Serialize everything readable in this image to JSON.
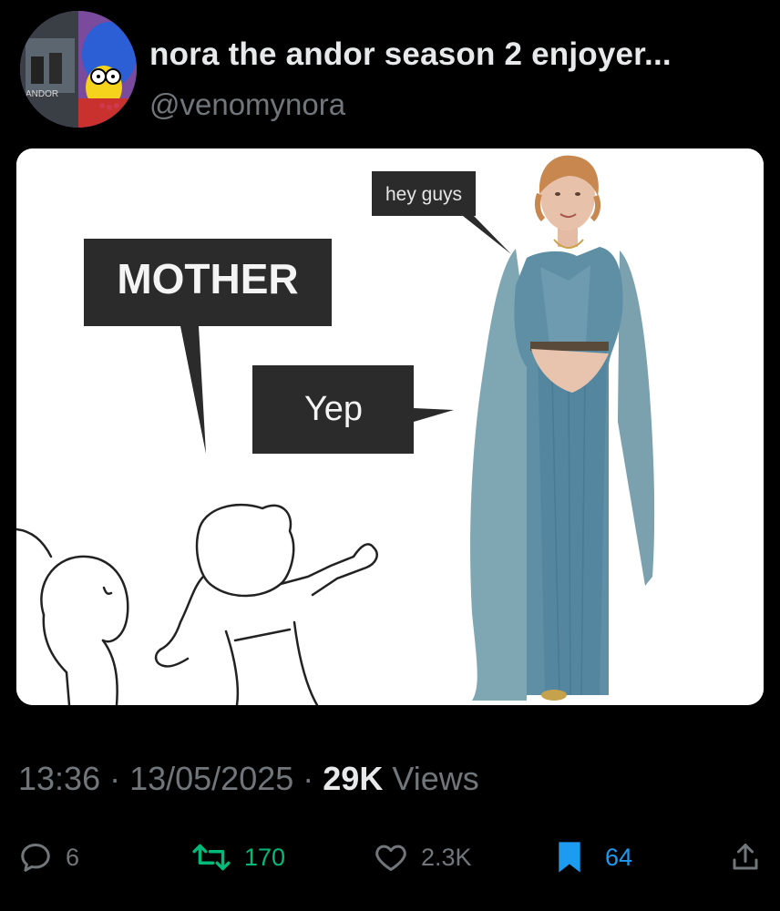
{
  "author": {
    "display_name": "nora the andor season 2 enjoyer...",
    "handle": "@venomynora",
    "avatar_label": "ANDOR"
  },
  "media": {
    "bubbles": {
      "hey": "hey guys",
      "mother": "MOTHER",
      "yep": "Yep"
    }
  },
  "meta": {
    "time": "13:36",
    "separator1": " · ",
    "date": "13/05/2025",
    "separator2": " · ",
    "views_count": "29K",
    "views_label": " Views"
  },
  "actions": {
    "replies": "6",
    "retweets": "170",
    "likes": "2.3K",
    "bookmarks": "64"
  },
  "colors": {
    "background": "#000000",
    "text_primary": "#e7e9ea",
    "text_secondary": "#71767b",
    "retweet_active": "#00ba7c",
    "bookmark_active": "#1d9bf0"
  },
  "icons": [
    "reply-icon",
    "retweet-icon",
    "like-icon",
    "bookmark-icon",
    "share-icon"
  ]
}
